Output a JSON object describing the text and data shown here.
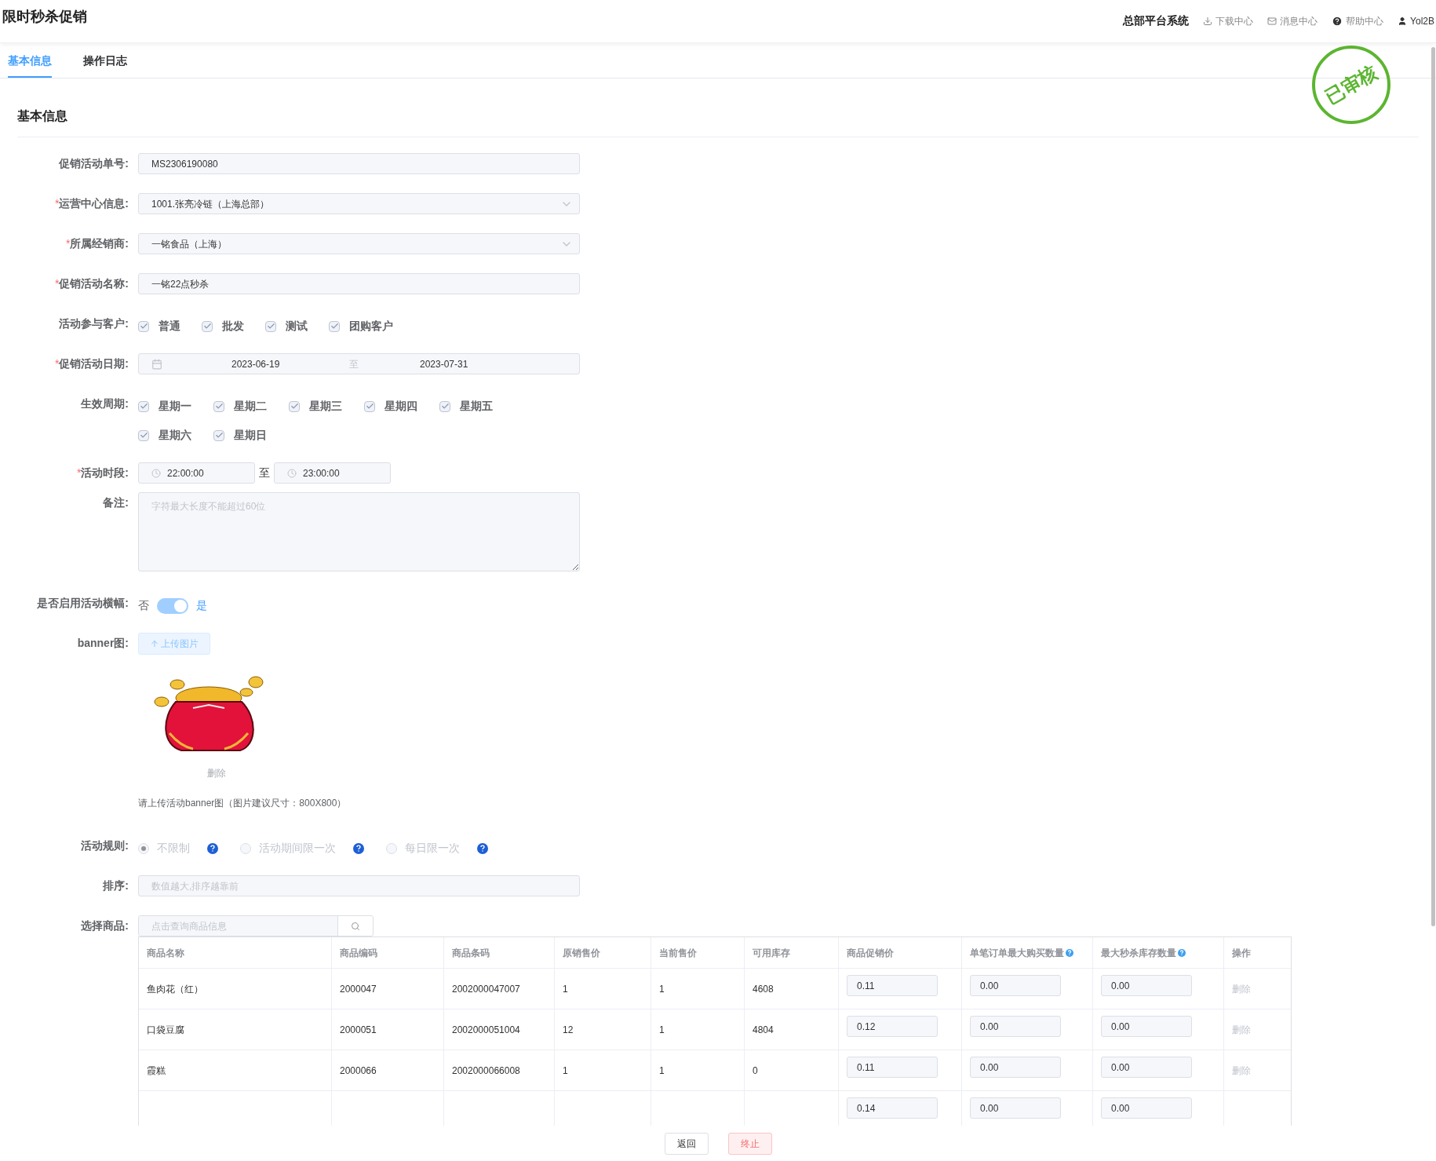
{
  "page_title": "限时秒杀促销",
  "header": {
    "system": "总部平台系统",
    "links": [
      {
        "kind": "download",
        "label": "下载中心"
      },
      {
        "kind": "message",
        "label": "消息中心"
      },
      {
        "kind": "help",
        "label": "帮助中心"
      },
      {
        "kind": "user",
        "label": "Yol2B"
      }
    ]
  },
  "tabs": [
    {
      "label": "基本信息",
      "selected": true
    },
    {
      "label": "操作日志",
      "selected": false
    }
  ],
  "stamp": "已审核",
  "section_title": "基本信息",
  "form": [
    {
      "kind": "text",
      "label": "促销活动单号:",
      "value": "MS2306190080"
    },
    {
      "kind": "select",
      "mark": "*",
      "label": "运营中心信息:",
      "value": "1001.张亮冷链（上海总部）"
    },
    {
      "kind": "select",
      "mark": "*",
      "label": "所属经销商:",
      "value": "一铭食品（上海）"
    },
    {
      "kind": "text",
      "mark": "*",
      "label": "促销活动名称:",
      "value": "一铭22点秒杀"
    },
    {
      "kind": "checkboxes",
      "label": "活动参与客户:",
      "options": [
        {
          "label": "普通",
          "checked": true
        },
        {
          "label": "批发",
          "checked": true
        },
        {
          "label": "测试",
          "checked": true
        },
        {
          "label": "团购客户",
          "checked": true
        }
      ]
    },
    {
      "kind": "daterange",
      "mark": "*",
      "label": "促销活动日期:",
      "start": "2023-06-19",
      "separator": "至",
      "end": "2023-07-31"
    },
    {
      "kind": "checkboxes",
      "label": "生效周期:",
      "options": [
        {
          "label": "星期一",
          "checked": true
        },
        {
          "label": "星期二",
          "checked": true
        },
        {
          "label": "星期三",
          "checked": true
        },
        {
          "label": "星期四",
          "checked": true
        },
        {
          "label": "星期五",
          "checked": true
        },
        {
          "label": "星期六",
          "checked": true
        },
        {
          "label": "星期日",
          "checked": true
        }
      ]
    },
    {
      "kind": "timerange",
      "mark": "*",
      "label": "活动时段:",
      "start": "22:00:00",
      "separator": "至",
      "end": "23:00:00"
    },
    {
      "kind": "textarea",
      "label": "备注:",
      "placeholder": "字符最大长度不能超过60位"
    },
    {
      "kind": "switch",
      "label": "是否启用活动横幅:",
      "off_label": "否",
      "on_label": "是",
      "on": true
    },
    {
      "kind": "upload",
      "label": "banner图:",
      "button": "上传图片",
      "delete": "删除",
      "hint": "请上传活动banner图（图片建议尺寸：800X800）"
    },
    {
      "kind": "radio",
      "label": "活动规则:",
      "options": [
        {
          "label": "不限制",
          "selected": true
        },
        {
          "label": "活动期间限一次",
          "selected": false
        },
        {
          "label": "每日限一次",
          "selected": false
        }
      ]
    },
    {
      "kind": "text",
      "label": "排序:",
      "placeholder": "数值越大,排序越靠前"
    },
    {
      "kind": "search",
      "label": "选择商品:",
      "placeholder": "点击查询商品信息"
    }
  ],
  "table": {
    "columns": [
      {
        "label": "商品名称",
        "kind": "text"
      },
      {
        "label": "商品编码",
        "kind": "text"
      },
      {
        "label": "商品条码",
        "kind": "text"
      },
      {
        "label": "原销售价",
        "kind": "text"
      },
      {
        "label": "当前售价",
        "kind": "text"
      },
      {
        "label": "可用库存",
        "kind": "text"
      },
      {
        "label": "商品促销价",
        "kind": "input"
      },
      {
        "label": "单笔订单最大购买数量",
        "kind": "input",
        "help": true
      },
      {
        "label": "最大秒杀库存数量",
        "kind": "input",
        "help": true
      },
      {
        "label": "操作",
        "kind": "action"
      }
    ],
    "rows": [
      {
        "cells": [
          "鱼肉花（红）",
          "2000047",
          "2002000047007",
          "1",
          "1",
          "4608",
          "0.11",
          "0.00",
          "0.00",
          "删除"
        ]
      },
      {
        "cells": [
          "口袋豆腐",
          "2000051",
          "2002000051004",
          "12",
          "1",
          "4804",
          "0.12",
          "0.00",
          "0.00",
          "删除"
        ]
      },
      {
        "cells": [
          "霞糕",
          "2000066",
          "2002000066008",
          "1",
          "1",
          "0",
          "0.11",
          "0.00",
          "0.00",
          "删除"
        ]
      },
      {
        "cells": [
          "",
          "",
          "",
          "",
          "",
          "",
          "0.14",
          "0.00",
          "0.00",
          ""
        ]
      }
    ]
  },
  "footer": {
    "back": "返回",
    "stop": "终止"
  }
}
